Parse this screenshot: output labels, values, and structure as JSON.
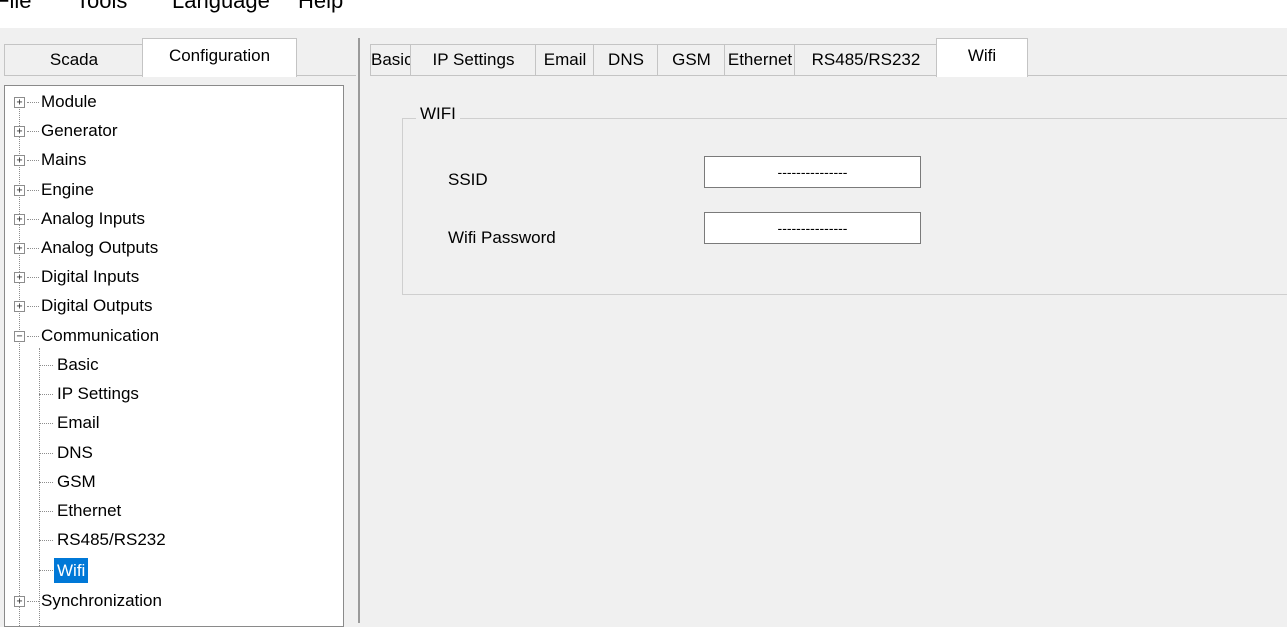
{
  "menu": {
    "file": "File",
    "tools": "Tools",
    "language": "Language",
    "help": "Help"
  },
  "left_tabs": [
    "Scada",
    "Configuration"
  ],
  "tree": {
    "roots_before": [
      "Module",
      "Generator",
      "Mains",
      "Engine",
      "Analog Inputs",
      "Analog Outputs",
      "Digital Inputs",
      "Digital Outputs"
    ],
    "expanded": "Communication",
    "children": [
      "Basic",
      "IP Settings",
      "Email",
      "DNS",
      "GSM",
      "Ethernet",
      "RS485/RS232",
      "Wifi"
    ],
    "selected": "Wifi",
    "roots_after": [
      "Synchronization"
    ]
  },
  "right_tabs": [
    "Basic",
    "IP Settings",
    "Email",
    "DNS",
    "GSM",
    "Ethernet",
    "RS485/RS232",
    "Wifi"
  ],
  "active_right_tab": "Wifi",
  "wifi": {
    "group_title": "WIFI",
    "ssid_label": "SSID",
    "ssid_value": "---------------",
    "password_label": "Wifi Password",
    "password_value": "---------------"
  },
  "colors": {
    "selection": "#0078d7",
    "window": "#f0f0f0"
  }
}
